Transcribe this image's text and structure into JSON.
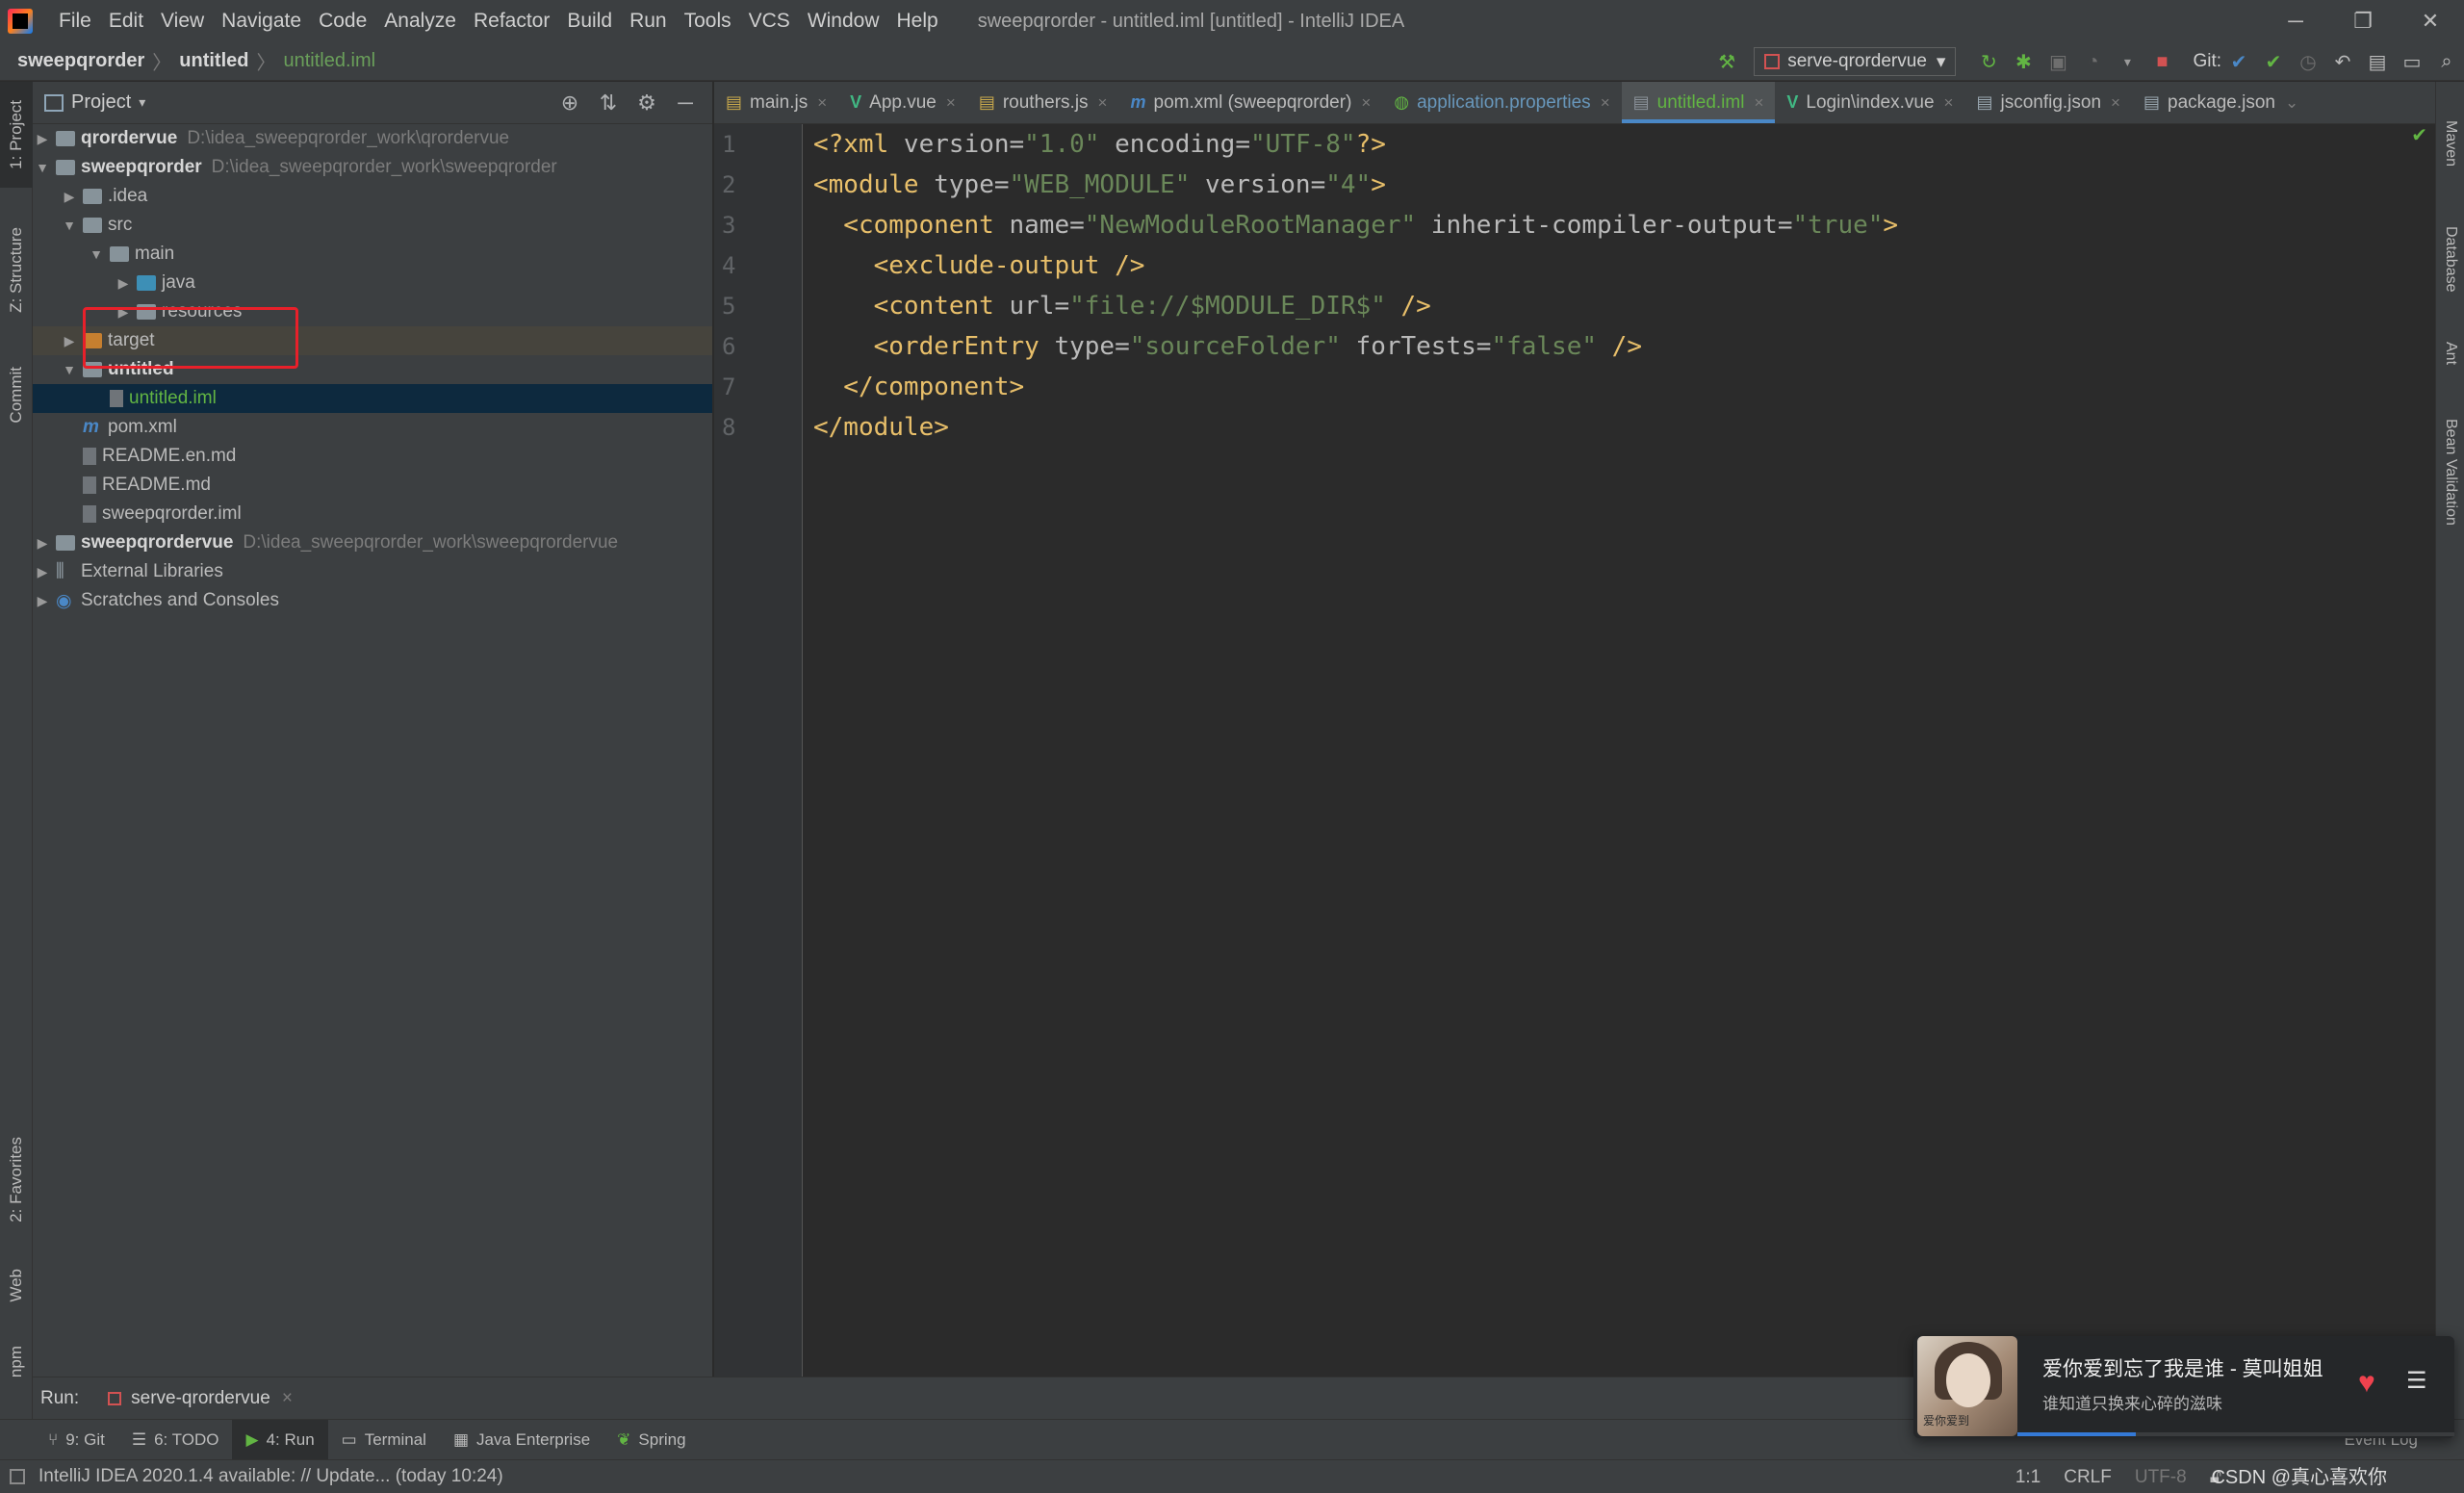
{
  "window": {
    "title": "sweepqrorder - untitled.iml [untitled] - IntelliJ IDEA",
    "menu": [
      "File",
      "Edit",
      "View",
      "Navigate",
      "Code",
      "Analyze",
      "Refactor",
      "Build",
      "Run",
      "Tools",
      "VCS",
      "Window",
      "Help"
    ]
  },
  "breadcrumb": {
    "project": "sweepqrorder",
    "module": "untitled",
    "file": "untitled.iml"
  },
  "run_config": "serve-qrordervue",
  "git_label": "Git:",
  "left_tabs": [
    "1: Project",
    "Z: Structure",
    "Commit",
    "2: Favorites",
    "Web",
    "npm"
  ],
  "right_tabs": [
    "Maven",
    "Database",
    "Ant",
    "Bean Validation"
  ],
  "project_panel": {
    "title": "Project",
    "tree": [
      {
        "label": "qrordervue",
        "path": "D:\\idea_sweepqrorder_work\\qrordervue"
      },
      {
        "label": "sweepqrorder",
        "path": "D:\\idea_sweepqrorder_work\\sweepqrorder"
      },
      {
        "label": ".idea"
      },
      {
        "label": "src"
      },
      {
        "label": "main"
      },
      {
        "label": "java"
      },
      {
        "label": "resources"
      },
      {
        "label": "target"
      },
      {
        "label": "untitled"
      },
      {
        "label": "untitled.iml"
      },
      {
        "label": "pom.xml"
      },
      {
        "label": "README.en.md"
      },
      {
        "label": "README.md"
      },
      {
        "label": "sweepqrorder.iml"
      },
      {
        "label": "sweepqrordervue",
        "path": "D:\\idea_sweepqrorder_work\\sweepqrordervue"
      },
      {
        "label": "External Libraries"
      },
      {
        "label": "Scratches and Consoles"
      }
    ]
  },
  "editor_tabs": [
    "main.js",
    "App.vue",
    "routhers.js",
    "pom.xml (sweepqrorder)",
    "application.properties",
    "untitled.iml",
    "Login\\index.vue",
    "jsconfig.json",
    "package.json"
  ],
  "line_numbers": [
    "1",
    "2",
    "3",
    "4",
    "5",
    "6",
    "7",
    "8"
  ],
  "code": {
    "l1": [
      "<?xml ",
      "version",
      "=",
      "\"1.0\"",
      " encoding",
      "=",
      "\"UTF-8\"",
      "?>"
    ],
    "l2": [
      "<module ",
      "type",
      "=",
      "\"WEB_MODULE\"",
      " version",
      "=",
      "\"4\"",
      ">"
    ],
    "l3": [
      "  <component ",
      "name",
      "=",
      "\"NewModuleRootManager\"",
      " inherit-compiler-output",
      "=",
      "\"true\"",
      ">"
    ],
    "l4": "    <exclude-output />",
    "l5": [
      "    <content ",
      "url",
      "=",
      "\"file://$MODULE_DIR$\"",
      " />"
    ],
    "l6": [
      "    <orderEntry ",
      "type",
      "=",
      "\"sourceFolder\"",
      " forTests",
      "=",
      "\"false\"",
      " />"
    ],
    "l7": "  </component>",
    "l8": "</module>"
  },
  "run_bar": {
    "label": "Run:",
    "tab": "serve-qrordervue"
  },
  "bottom_tools": [
    "9: Git",
    "6: TODO",
    "4: Run",
    "Terminal",
    "Java Enterprise",
    "Spring"
  ],
  "event_log": "Event Log",
  "status": {
    "message": "IntelliJ IDEA 2020.1.4 available: // Update... (today 10:24)",
    "position": "1:1",
    "line_sep": "CRLF",
    "encoding": "UTF-8"
  },
  "watermark": "CSDN @真心喜欢你",
  "music": {
    "song": "爱你爱到忘了我是谁 - 莫叫姐姐",
    "lyric": "谁知道只换来心碎的滋味",
    "cover_text": "爱你爱到",
    "progress": 0.27
  }
}
